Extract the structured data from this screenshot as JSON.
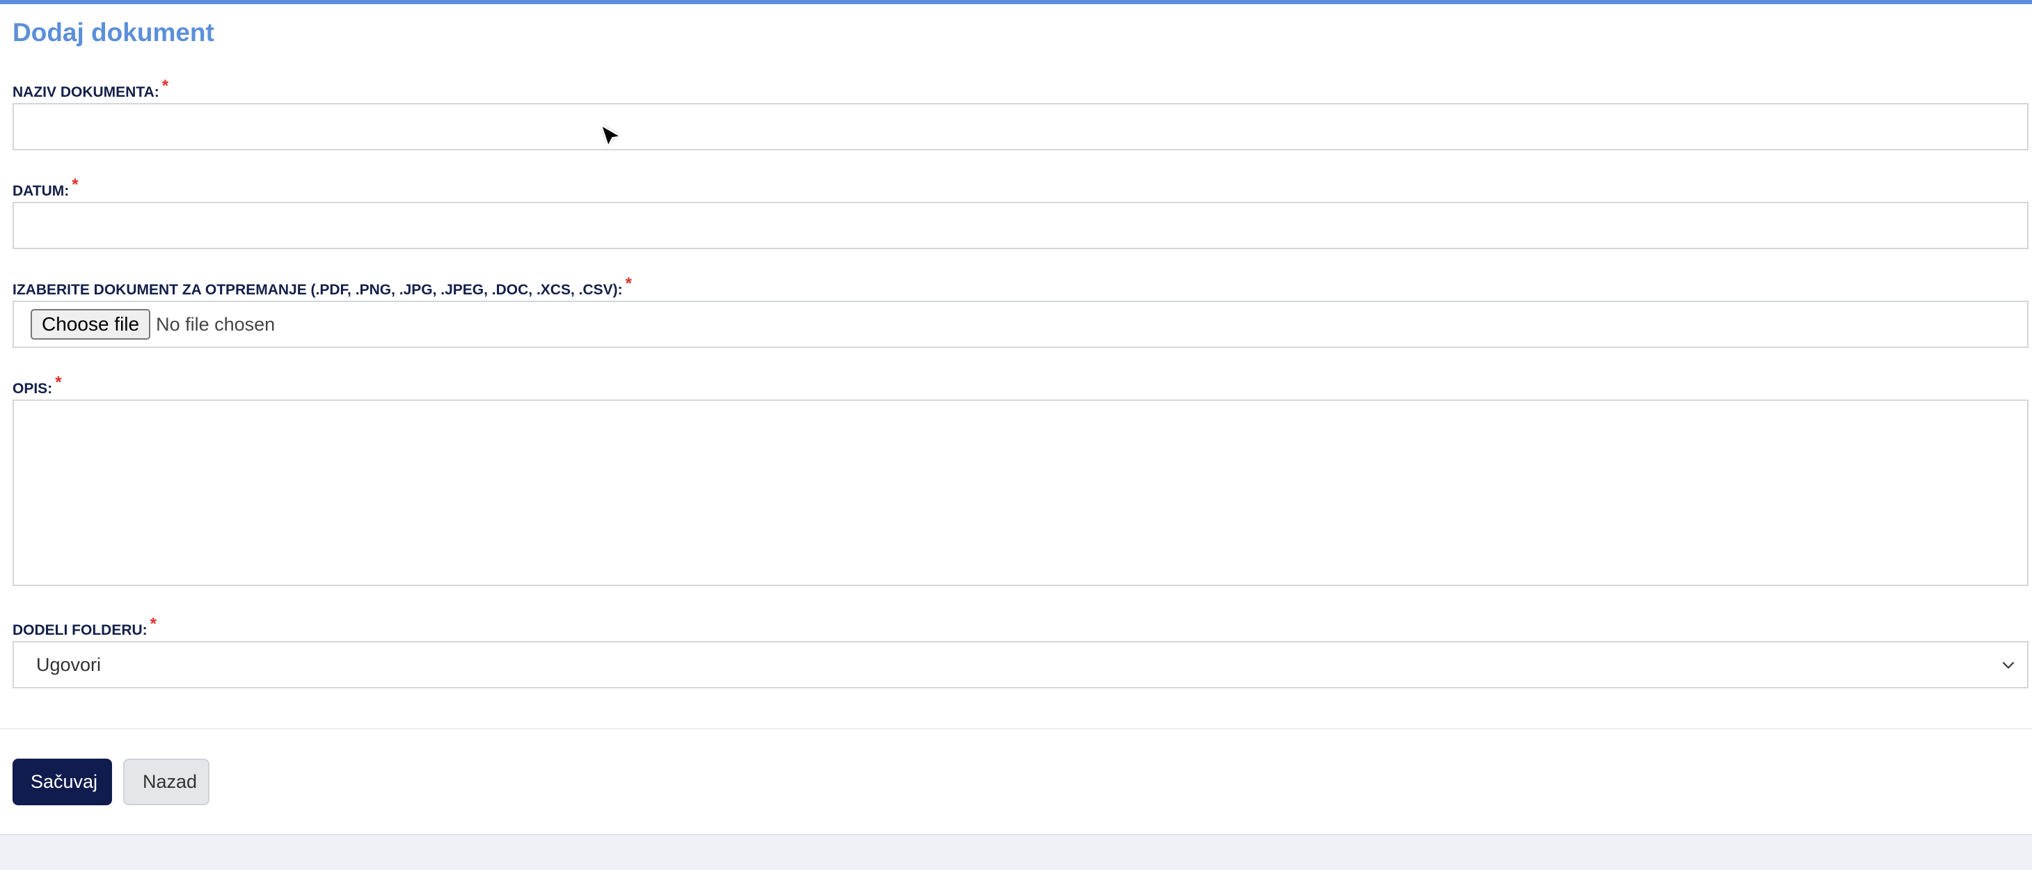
{
  "page": {
    "title": "Dodaj dokument"
  },
  "form": {
    "name": {
      "label": "NAZIV DOKUMENTA:",
      "value": "",
      "required_mark": "*"
    },
    "date": {
      "label": "DATUM:",
      "value": "",
      "required_mark": "*"
    },
    "file": {
      "label": "IZABERITE DOKUMENT ZA OTPREMANJE (.PDF, .PNG, .JPG, .JPEG, .DOC, .XCS, .CSV):",
      "button_label": "Choose file",
      "status": "No file chosen",
      "required_mark": "*"
    },
    "description": {
      "label": "OPIS:",
      "value": "",
      "required_mark": "*"
    },
    "folder": {
      "label": "DODELI FOLDERU:",
      "selected": "Ugovori",
      "required_mark": "*"
    }
  },
  "actions": {
    "save_label": "Sačuvaj",
    "back_label": "Nazad"
  },
  "colors": {
    "accent": "#5b8fd9",
    "primary_button": "#101c4e",
    "label_text": "#14204a",
    "required": "#e0302a"
  },
  "icons": {
    "cursor": "mouse-pointer-icon",
    "select_arrow": "chevron-down-icon"
  }
}
